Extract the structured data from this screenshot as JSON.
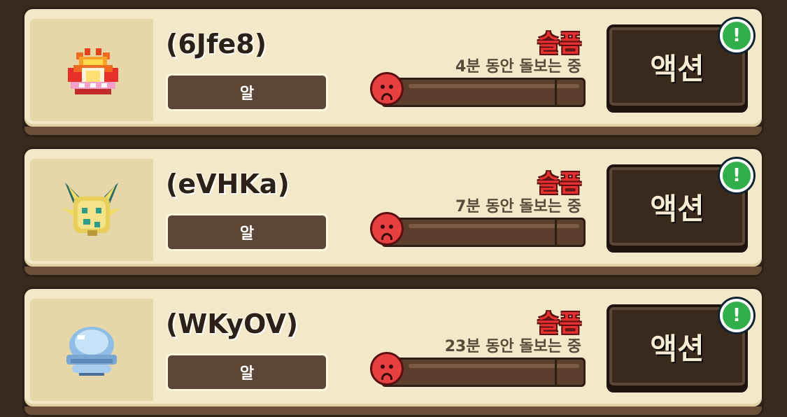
{
  "pets": [
    {
      "name": "(6Jfe8)",
      "stage": "알",
      "mood": "슬픔",
      "care_time": "4분 동안 돌보는 중",
      "action_label": "액션",
      "alert_symbol": "!",
      "icon": "flame-crown-egg-icon",
      "mood_level": 0.05
    },
    {
      "name": "(eVHKa)",
      "stage": "알",
      "mood": "슬픔",
      "care_time": "7분 동안 돌보는 중",
      "action_label": "액션",
      "alert_symbol": "!",
      "icon": "spiky-gold-creature-icon",
      "mood_level": 0.05
    },
    {
      "name": "(WKyOV)",
      "stage": "알",
      "mood": "슬픔",
      "care_time": "23분 동안 돌보는 중",
      "action_label": "액션",
      "alert_symbol": "!",
      "icon": "blue-shell-egg-icon",
      "mood_level": 0.05
    }
  ],
  "colors": {
    "card_bg": "#f3e9c8",
    "mood_red": "#e53030",
    "alert_green": "#2fae49",
    "button_brown": "#3a2a1e"
  }
}
